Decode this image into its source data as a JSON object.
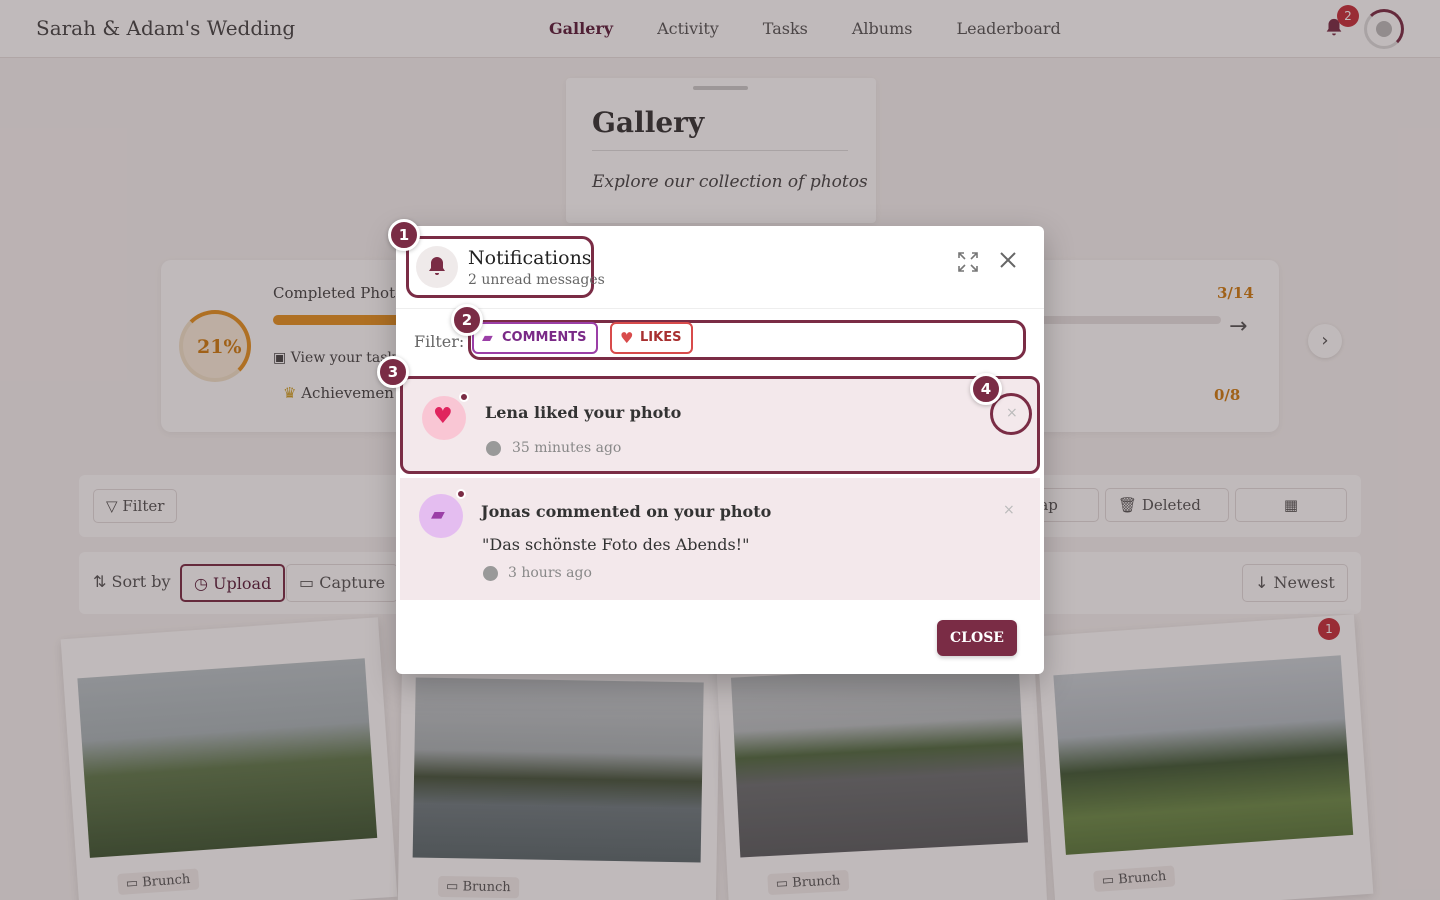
{
  "app": {
    "title": "Sarah & Adam's Wedding"
  },
  "nav": [
    {
      "label": "Gallery",
      "active": true
    },
    {
      "label": "Activity"
    },
    {
      "label": "Tasks"
    },
    {
      "label": "Albums"
    },
    {
      "label": "Leaderboard"
    }
  ],
  "header": {
    "notification_count": "2",
    "accent": "#7a2c45",
    "badge_color": "#c62f3a"
  },
  "gallery": {
    "title": "Gallery",
    "subtitle": "Explore our collection of photos"
  },
  "progress": {
    "percent_label": "21%",
    "completed_label": "Completed Photo",
    "view_tasks": "View your task",
    "achievements": "Achievemen",
    "fraction_top": "3/14",
    "fraction_bottom": "0/8",
    "accent": "#e6921f"
  },
  "toolbar": {
    "filter": "Filter",
    "map": "Map",
    "deleted": "Deleted"
  },
  "sortbar": {
    "sort_by": "Sort by",
    "upload": "Upload",
    "capture": "Capture",
    "newest": "Newest"
  },
  "photos": [
    {
      "tag": "Brunch"
    },
    {
      "tag": "Brunch"
    },
    {
      "tag": "Brunch"
    },
    {
      "tag": "Brunch",
      "likes": "1"
    }
  ],
  "modal": {
    "title": "Notifications",
    "subtitle": "2 unread messages",
    "filter_label": "Filter:",
    "chips": {
      "comments": "COMMENTS",
      "likes": "LIKES"
    },
    "notifications": [
      {
        "title": "Lena liked your photo",
        "time": "35 minutes ago",
        "icon": "heart-icon"
      },
      {
        "title": "Jonas commented on your photo",
        "quote": "\"Das schönste Foto des Abends!\"",
        "time": "3 hours ago",
        "icon": "comment-icon"
      }
    ],
    "close_label": "CLOSE"
  },
  "markers": [
    "1",
    "2",
    "3",
    "4"
  ]
}
